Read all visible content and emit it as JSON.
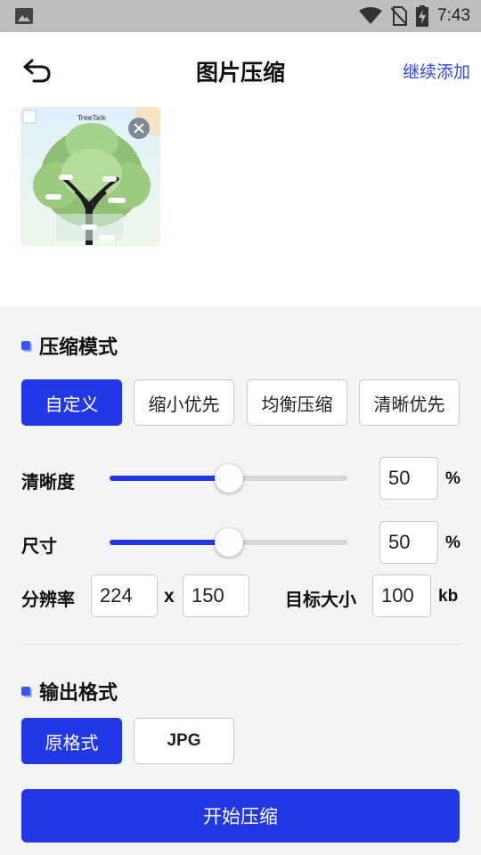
{
  "status_bar": {
    "time": "7:43"
  },
  "header": {
    "title": "图片压缩",
    "add_more": "继续添加"
  },
  "thumbnail": {
    "caption": "TreeTalk"
  },
  "compress_mode": {
    "title": "压缩模式",
    "options": [
      "自定义",
      "缩小优先",
      "均衡压缩",
      "清晰优先"
    ],
    "selected": "自定义"
  },
  "clarity": {
    "label": "清晰度",
    "value": "50",
    "unit": "%",
    "percent": 50
  },
  "size": {
    "label": "尺寸",
    "value": "50",
    "unit": "%",
    "percent": 50
  },
  "resolution": {
    "label": "分辨率",
    "width": "224",
    "separator": "x",
    "height": "150"
  },
  "target_size": {
    "label": "目标大小",
    "value": "100",
    "unit": "kb"
  },
  "output_format": {
    "title": "输出格式",
    "options": [
      "原格式",
      "JPG"
    ],
    "selected": "原格式"
  },
  "start_button": "开始压缩",
  "colors": {
    "accent": "#2238e8",
    "link": "#2f49e6"
  }
}
